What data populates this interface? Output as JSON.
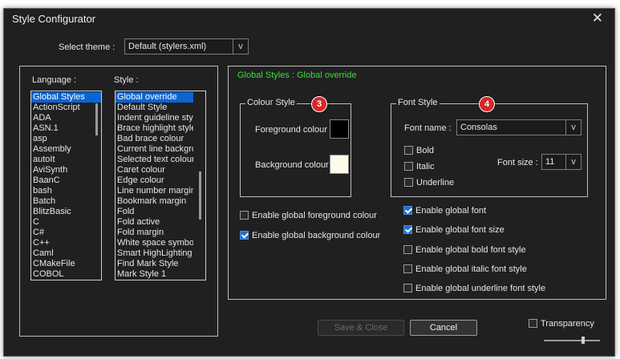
{
  "window": {
    "title": "Style Configurator",
    "close_glyph": "✕"
  },
  "theme": {
    "label": "Select theme :",
    "value": "Default (stylers.xml)",
    "arrow": "v"
  },
  "language_list": {
    "label": "Language :",
    "selected": "Global Styles",
    "items": [
      "Global Styles",
      "ActionScript",
      "ADA",
      "ASN.1",
      "asp",
      "Assembly",
      "autoIt",
      "AviSynth",
      "BaanC",
      "bash",
      "Batch",
      "BlitzBasic",
      "C",
      "C#",
      "C++",
      "Caml",
      "CMakeFile",
      "COBOL"
    ]
  },
  "style_list": {
    "label": "Style :",
    "selected": "Global override",
    "items": [
      "Global override",
      "Default Style",
      "Indent guideline style",
      "Brace highlight style",
      "Bad brace colour",
      "Current line background colour",
      "Selected text colour",
      "Caret colour",
      "Edge colour",
      "Line number margin",
      "Bookmark margin",
      "Fold",
      "Fold active",
      "Fold margin",
      "White space symbol",
      "Smart HighLighting",
      "Find Mark Style",
      "Mark Style 1"
    ]
  },
  "heading": {
    "text": "Global Styles : Global override",
    "color": "#3ddc3d"
  },
  "colour_style": {
    "legend": "Colour Style",
    "badge": "3",
    "foreground_label": "Foreground colour",
    "foreground_color": "#000000",
    "background_label": "Background colour",
    "background_color": "#fffbe8"
  },
  "font_style": {
    "legend": "Font Style",
    "badge": "4",
    "font_name_label": "Font name :",
    "font_name_value": "Consolas",
    "bold_label": "Bold",
    "italic_label": "Italic",
    "underline_label": "Underline",
    "font_size_label": "Font size :",
    "font_size_value": "11",
    "arrow": "v"
  },
  "global_checks": {
    "fg_colour": {
      "label": "Enable global foreground colour",
      "checked": false
    },
    "bg_colour": {
      "label": "Enable global background colour",
      "checked": true
    },
    "font": {
      "label": "Enable global font",
      "checked": true
    },
    "font_size": {
      "label": "Enable global font size",
      "checked": true
    },
    "bold": {
      "label": "Enable global bold font style",
      "checked": false
    },
    "italic": {
      "label": "Enable global italic font style",
      "checked": false
    },
    "underline": {
      "label": "Enable global underline font style",
      "checked": false
    }
  },
  "buttons": {
    "save_close": "Save & Close",
    "cancel": "Cancel"
  },
  "transparency": {
    "label": "Transparency",
    "checked": false,
    "level": 0.7
  },
  "colors": {
    "window_bg": "#202020",
    "selection": "#0a64d2",
    "badge_red": "#d9262b"
  }
}
